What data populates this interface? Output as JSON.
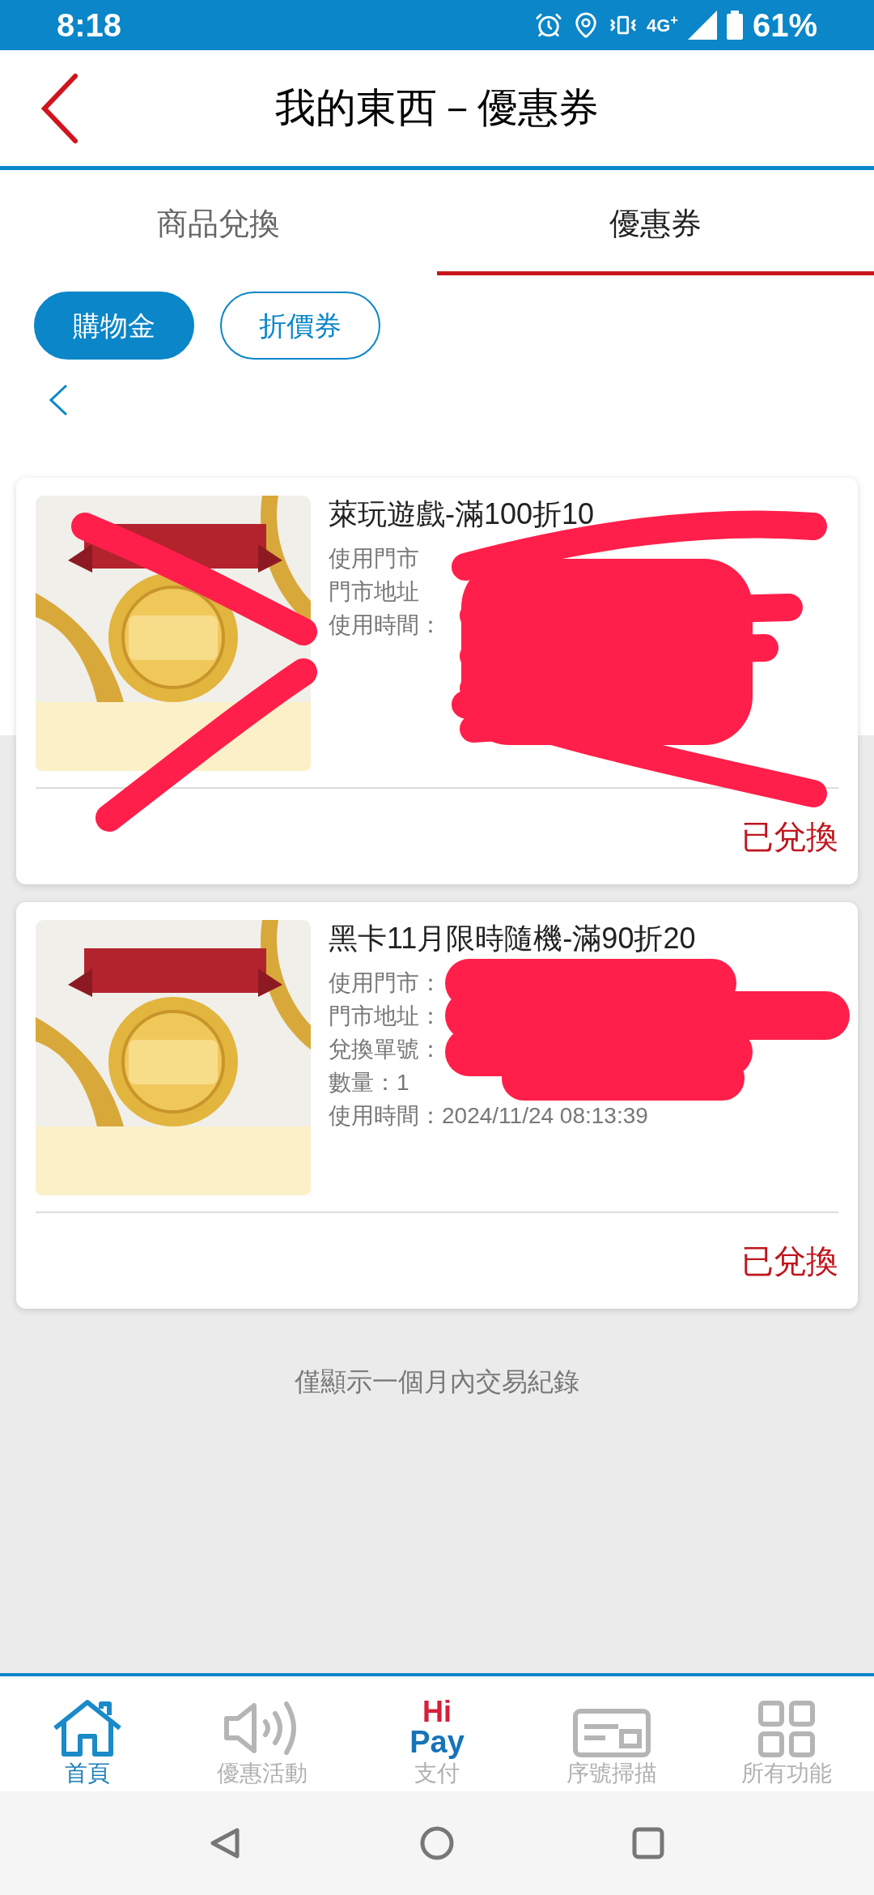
{
  "status_bar": {
    "time": "8:18",
    "network": "4G$^{+}$",
    "battery": "61%"
  },
  "header": {
    "title": "我的東西－優惠券"
  },
  "tabs": [
    {
      "label": "商品兌換",
      "selected": false
    },
    {
      "label": "優惠券",
      "selected": true
    }
  ],
  "filters": [
    {
      "label": "購物金",
      "selected": true
    },
    {
      "label": "折價券",
      "selected": false
    }
  ],
  "coupons": [
    {
      "title": "萊玩遊戲-滿100折10",
      "kind": "crossed",
      "details": [
        "使用門市",
        "門市地址",
        "使用時間："
      ],
      "status": "已兌換"
    },
    {
      "title": "黑卡11月限時隨機-滿90折20",
      "kind": "blotted",
      "details": [
        "使用門市：",
        "門市地址：",
        "兌換單號：",
        "數量：1",
        "使用時間：2024/11/24 08:13:39"
      ],
      "status": "已兌換"
    }
  ],
  "footer_note": "僅顯示一個月內交易紀錄",
  "bottom_nav": [
    {
      "kind": "home",
      "label": "首頁",
      "selected": true
    },
    {
      "kind": "speaker",
      "label": "優惠活動",
      "selected": false
    },
    {
      "kind": "logo",
      "logo_top": "Hi",
      "logo_bottom": "Pay",
      "label": "支付",
      "selected": false
    },
    {
      "kind": "scan",
      "label": "序號掃描",
      "selected": false
    },
    {
      "kind": "grid",
      "label": "所有功能",
      "selected": false
    }
  ]
}
